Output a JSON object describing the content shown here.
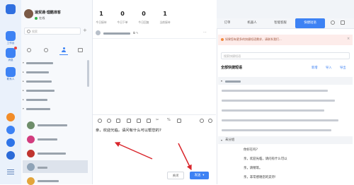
{
  "rail": {
    "items": [
      {
        "label": "工作台",
        "icon": "workbench-icon"
      },
      {
        "label": "消息",
        "icon": "message-icon"
      },
      {
        "label": "联系人",
        "icon": "contacts-icon"
      }
    ]
  },
  "profile": {
    "name": "速贸通·理酷准客",
    "status": "在线",
    "status_color": "#32b44a"
  },
  "stats": [
    {
      "value": "1",
      "label": "今日接待"
    },
    {
      "value": "0",
      "label": "今日下单"
    },
    {
      "value": "0",
      "label": "今日回复"
    },
    {
      "value": "1",
      "label": "当前接待"
    }
  ],
  "search": {
    "placeholder": "搜索"
  },
  "chat": {
    "input_text": "亲，欢迎光临，请问有什么可以帮您的?",
    "send_label": "发送",
    "close_label": "关闭"
  },
  "right_tabs": [
    {
      "label": "订单",
      "active": false
    },
    {
      "label": "机器人",
      "active": false
    },
    {
      "label": "智能客服",
      "active": false
    },
    {
      "label": "快捷短语",
      "active": true
    }
  ],
  "notice": "如果您有更多的快捷短语需求，请联系我们...",
  "quick": {
    "search_placeholder": "搜索快捷短语",
    "section_title": "全部快捷短语",
    "actions": [
      "新增",
      "导入",
      "导出"
    ],
    "group1": "常用问候",
    "group2": "未分组",
    "group2_items": [
      "你好在吗?",
      "亲，欢迎光临，请问有什么可以",
      "亲，请稍等。",
      "亲，非常感谢您的支持!"
    ]
  },
  "colors": {
    "accent": "#3d82f4",
    "arrow": "#d9262c",
    "notice_bg": "#fdecea"
  }
}
